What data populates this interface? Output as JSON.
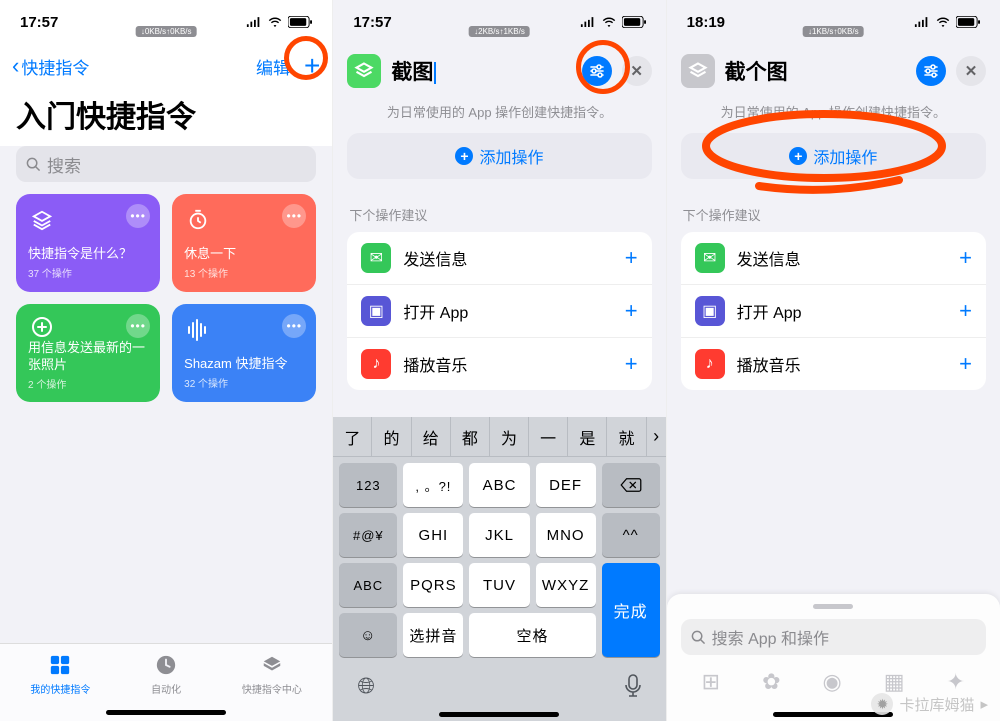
{
  "phone1": {
    "time": "17:57",
    "net": "↓0KB/s↑0KB/s",
    "back": "快捷指令",
    "edit": "编辑",
    "title": "入门快捷指令",
    "search_ph": "搜索",
    "cards": [
      {
        "title": "快捷指令是什么？",
        "sub": "37 个操作"
      },
      {
        "title": "休息一下",
        "sub": "13 个操作"
      },
      {
        "title": "用信息发送最新的一张照片",
        "sub": "2 个操作"
      },
      {
        "title": "Shazam 快捷指令",
        "sub": "32 个操作"
      }
    ],
    "tabs": [
      "我的快捷指令",
      "自动化",
      "快捷指令中心"
    ]
  },
  "phone2": {
    "time": "17:57",
    "net": "↓2KB/s↑1KB/s",
    "name": "截图",
    "hint": "为日常使用的 App 操作创建快捷指令。",
    "add": "添加操作",
    "section": "下个操作建议",
    "rows": [
      "发送信息",
      "打开 App",
      "播放音乐"
    ],
    "cand": [
      "了",
      "的",
      "给",
      "都",
      "为",
      "一",
      "是",
      "就"
    ],
    "keys": {
      "r1": [
        "123",
        ", 。?!",
        "ABC",
        "DEF",
        "bksp"
      ],
      "r2": [
        "#@¥",
        "GHI",
        "JKL",
        "MNO",
        "^^"
      ],
      "r3": [
        "ABC",
        "PQRS",
        "TUV",
        "WXYZ",
        "完成"
      ],
      "r4": [
        "emoji",
        "选拼音",
        "空格",
        "done-cont"
      ]
    }
  },
  "phone3": {
    "time": "18:19",
    "net": "↓1KB/s↑0KB/s",
    "name": "截个图",
    "hint": "为日常使用的 App 操作创建快捷指令。",
    "add": "添加操作",
    "section": "下个操作建议",
    "rows": [
      "发送信息",
      "打开 App",
      "播放音乐"
    ],
    "search_ph": "搜索 App 和操作"
  },
  "watermark": "卡拉库姆猫"
}
